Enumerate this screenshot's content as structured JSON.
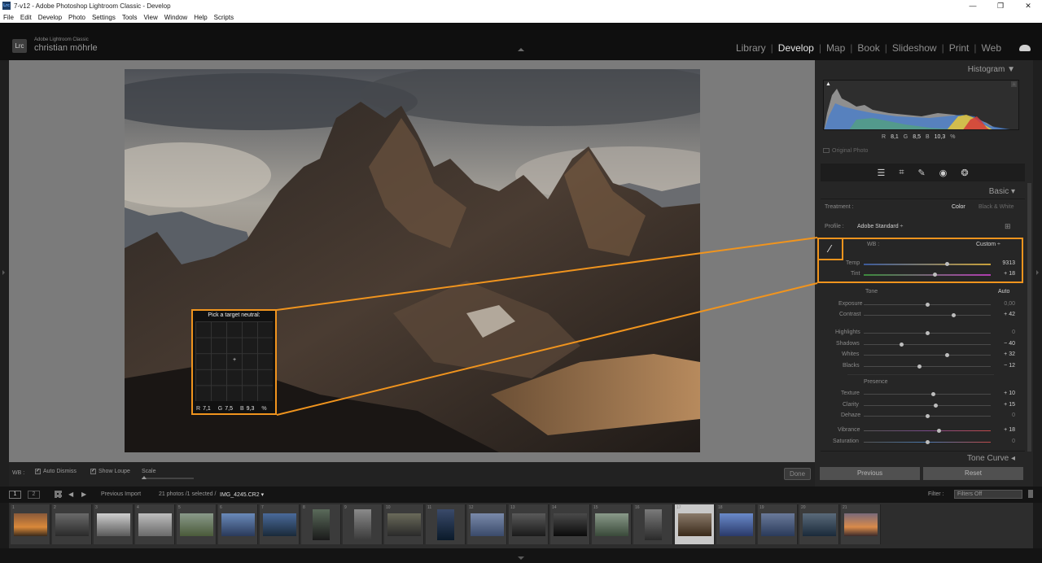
{
  "window": {
    "title": "7-v12 - Adobe Photoshop Lightroom Classic - Develop",
    "controls": [
      "—",
      "❐",
      "✕"
    ]
  },
  "menu": [
    "File",
    "Edit",
    "Develop",
    "Photo",
    "Settings",
    "Tools",
    "View",
    "Window",
    "Help",
    "Scripts"
  ],
  "identity": {
    "logo": "Lrc",
    "app_small": "Adobe Lightroom Classic",
    "user": "christian möhrle"
  },
  "modules": [
    "Library",
    "Develop",
    "Map",
    "Book",
    "Slideshow",
    "Print",
    "Web"
  ],
  "active_module": "Develop",
  "loupe": {
    "title": "Pick a target neutral:",
    "r_label": "R",
    "r": "7,1",
    "g_label": "G",
    "g": "7,5",
    "b_label": "B",
    "b": "9,3",
    "pct": "%"
  },
  "toolbar": {
    "wb": "WB :",
    "auto_dismiss": "Auto Dismiss",
    "show_loupe": "Show Loupe",
    "scale": "Scale",
    "done": "Done"
  },
  "panel": {
    "histogram": "Histogram",
    "r_label": "R",
    "r": "8,1",
    "g_label": "G",
    "g": "8,5",
    "b_label": "B",
    "b": "10,3",
    "pct": "%",
    "original_photo": "Original Photo",
    "basic": "Basic",
    "treatment": "Treatment :",
    "color": "Color",
    "bw": "Black & White",
    "profile": "Profile :",
    "profile_value": "Adobe Standard ÷",
    "wb": "WB :",
    "wb_value": "Custom ÷",
    "tone": "Tone",
    "auto": "Auto",
    "presence": "Presence",
    "tone_curve": "Tone Curve",
    "previous": "Previous",
    "reset": "Reset"
  },
  "sliders": {
    "temp": {
      "label": "Temp",
      "value": "9313",
      "pos": 0.66
    },
    "tint": {
      "label": "Tint",
      "value": "+ 18",
      "pos": 0.56
    },
    "exposure": {
      "label": "Exposure",
      "value": "0,00",
      "pos": 0.5
    },
    "contrast": {
      "label": "Contrast",
      "value": "+ 42",
      "pos": 0.71
    },
    "highlights": {
      "label": "Highlights",
      "value": "0",
      "pos": 0.5
    },
    "shadows": {
      "label": "Shadows",
      "value": "− 40",
      "pos": 0.3
    },
    "whites": {
      "label": "Whites",
      "value": "+ 32",
      "pos": 0.66
    },
    "blacks": {
      "label": "Blacks",
      "value": "− 12",
      "pos": 0.44
    },
    "texture": {
      "label": "Texture",
      "value": "+ 10",
      "pos": 0.55
    },
    "clarity": {
      "label": "Clarity",
      "value": "+ 15",
      "pos": 0.57
    },
    "dehaze": {
      "label": "Dehaze",
      "value": "0",
      "pos": 0.5
    },
    "vibrance": {
      "label": "Vibrance",
      "value": "+ 18",
      "pos": 0.59
    },
    "saturation": {
      "label": "Saturation",
      "value": "0",
      "pos": 0.5
    }
  },
  "filmstrip_bar": {
    "page1": "1",
    "page2": "2",
    "source": "Previous Import",
    "info": "21 photos /1 selected /",
    "file": "IMG_4245.CR2 ▾",
    "filter_label": "Filter :",
    "filter_value": "Filters Off"
  },
  "filmstrip": [
    "1",
    "2",
    "3",
    "4",
    "5",
    "6",
    "7",
    "8",
    "9",
    "10",
    "11",
    "12",
    "13",
    "14",
    "15",
    "16",
    "17",
    "18",
    "19",
    "20",
    "21"
  ],
  "selected_index": 17,
  "accent_color": "#f0941e"
}
